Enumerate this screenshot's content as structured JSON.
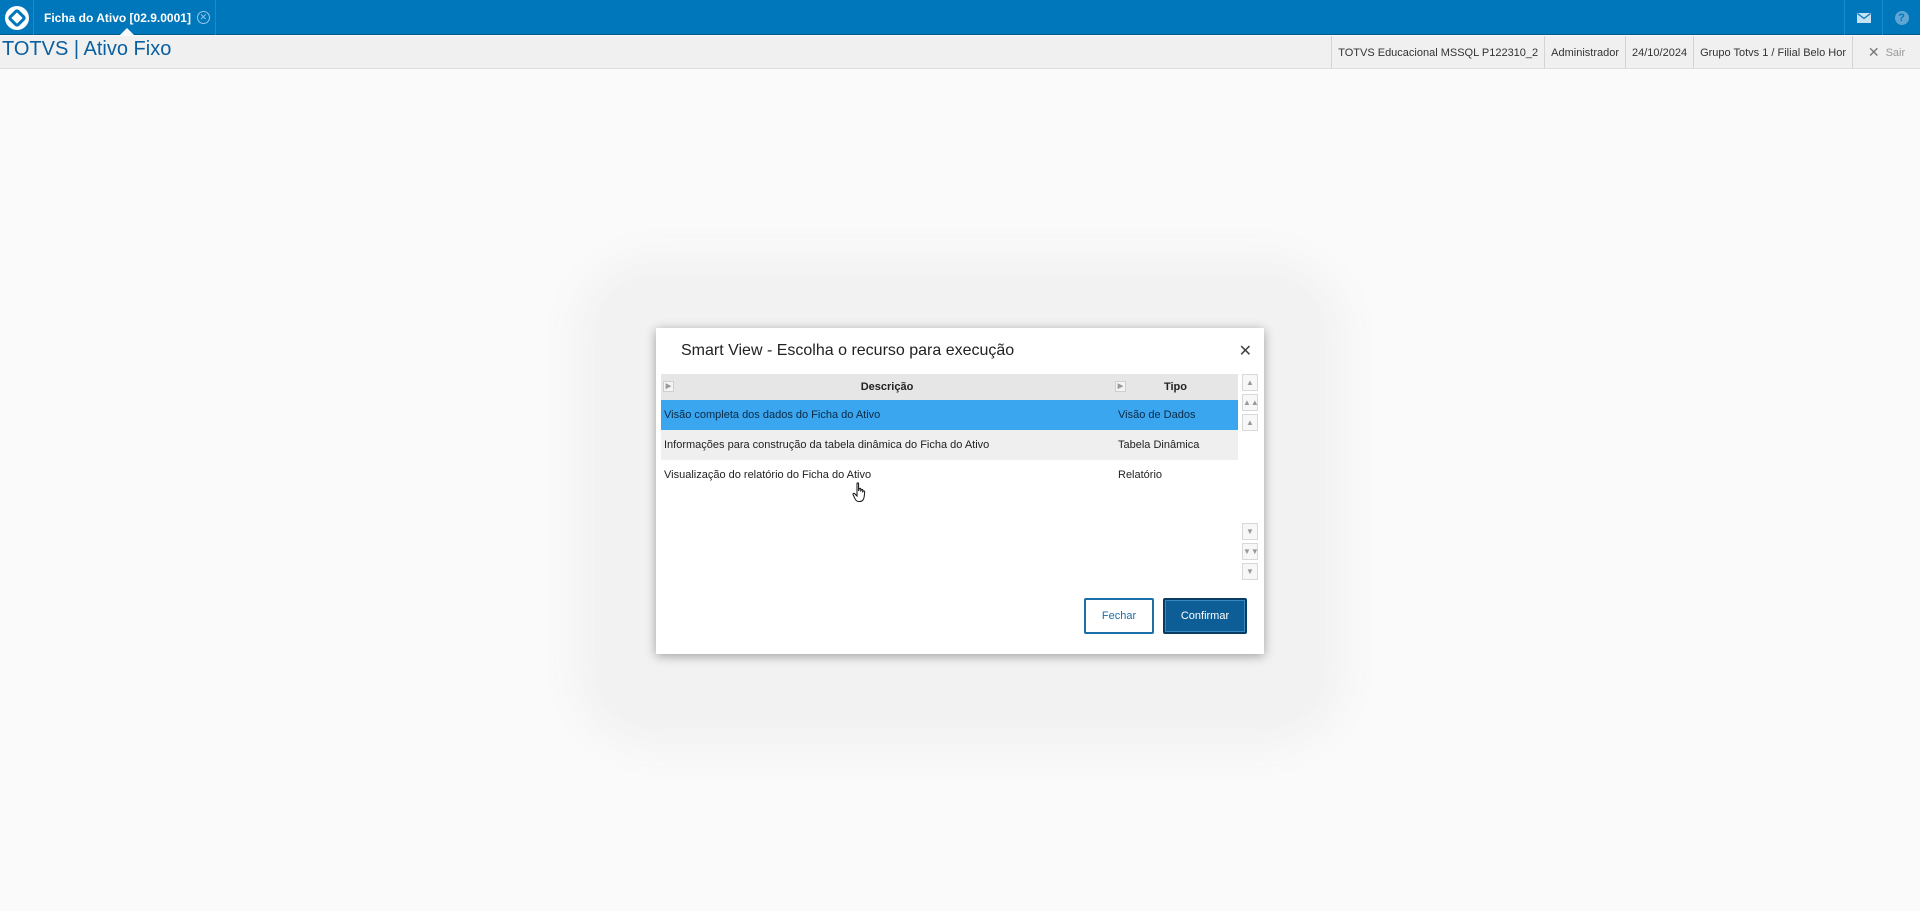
{
  "topbar": {
    "tab_label": "Ficha do Ativo [02.9.0001]",
    "tab_close_symbol": "✕",
    "mail_icon": "mail-icon",
    "help_symbol": "?"
  },
  "header": {
    "app_title": "TOTVS | Ativo Fixo",
    "environment": "TOTVS Educacional MSSQL P122310_2",
    "user": "Administrador",
    "date": "24/10/2024",
    "branch": "Grupo Totvs 1 / Filial Belo Hor",
    "exit_label": "Sair"
  },
  "dialog": {
    "title": "Smart View - Escolha o recurso para execução",
    "close_symbol": "✕",
    "columns": {
      "description": "Descrição",
      "type": "Tipo"
    },
    "rows": [
      {
        "description": "Visão completa dos dados do Ficha do Ativo",
        "type": "Visão de Dados",
        "selected": true
      },
      {
        "description": "Informações para construção da tabela dinâmica do Ficha do Ativo",
        "type": "Tabela Dinâmica",
        "selected": false
      },
      {
        "description": "Visualização do relatório do Ficha do Ativo",
        "type": "Relatório",
        "selected": false
      }
    ],
    "buttons": {
      "close": "Fechar",
      "confirm": "Confirmar"
    }
  },
  "colors": {
    "topbar": "#0076bb",
    "selected_row": "#3aa6ef",
    "primary_button": "#0d5e96",
    "title_text": "#0a5fa0"
  }
}
